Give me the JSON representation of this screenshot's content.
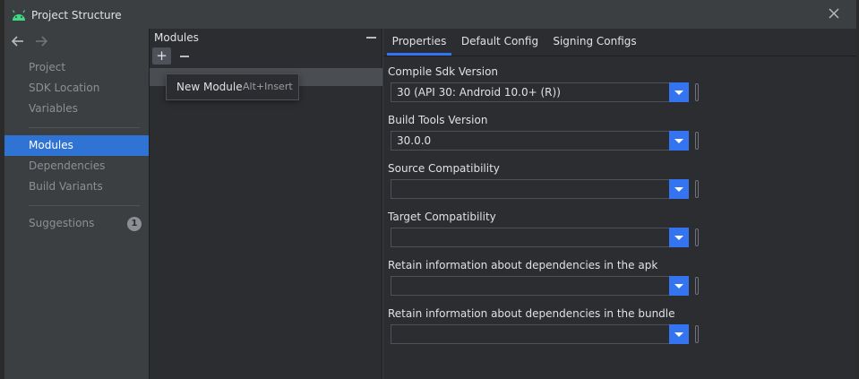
{
  "window": {
    "title": "Project Structure"
  },
  "leftnav": {
    "items": [
      {
        "label": "Project"
      },
      {
        "label": "SDK Location"
      },
      {
        "label": "Variables"
      },
      {
        "label": "Modules"
      },
      {
        "label": "Dependencies"
      },
      {
        "label": "Build Variants"
      },
      {
        "label": "Suggestions",
        "badge": "1"
      }
    ]
  },
  "modules": {
    "header": "Modules",
    "add_label": "+",
    "popup": {
      "label": "New Module",
      "shortcut": "Alt+Insert"
    }
  },
  "tabs": [
    {
      "label": "Properties"
    },
    {
      "label": "Default Config"
    },
    {
      "label": "Signing Configs"
    }
  ],
  "properties": [
    {
      "label": "Compile Sdk Version",
      "value": "30 (API 30: Android 10.0+ (R))"
    },
    {
      "label": "Build Tools Version",
      "value": "30.0.0"
    },
    {
      "label": "Source Compatibility",
      "value": ""
    },
    {
      "label": "Target Compatibility",
      "value": ""
    },
    {
      "label": "Retain information about dependencies in the apk",
      "value": ""
    },
    {
      "label": "Retain information about dependencies in the bundle",
      "value": ""
    }
  ],
  "colors": {
    "accent": "#3574f0",
    "selection": "#2f73d4",
    "android_green": "#3ddc84"
  }
}
